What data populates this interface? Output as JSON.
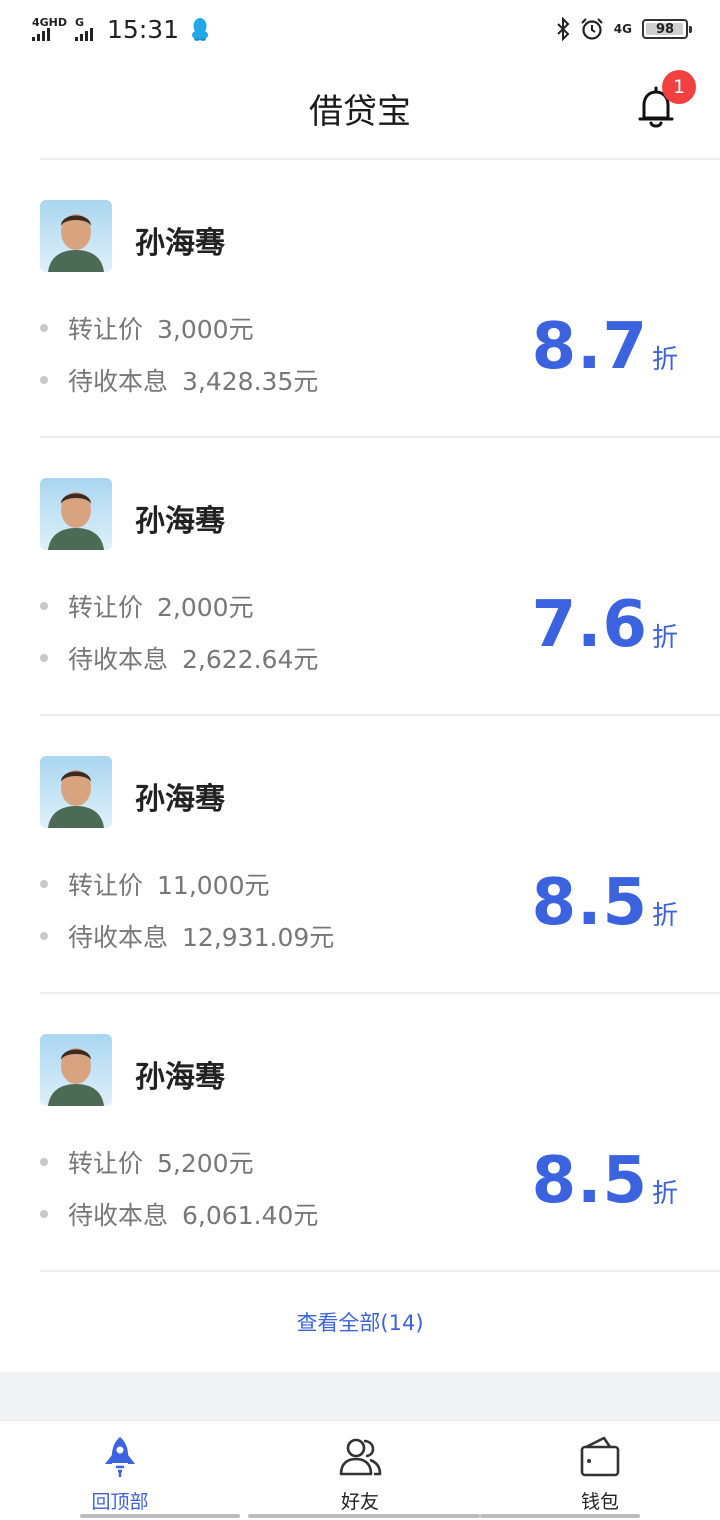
{
  "status_bar": {
    "sim1": "4GHD",
    "sim2": "G",
    "time": "15:31",
    "net": "4G",
    "battery": "98",
    "battery_level": 0.98
  },
  "header": {
    "title": "借贷宝",
    "notification_count": "1"
  },
  "cards": [
    {
      "name": "孙海骞",
      "transfer_label": "转让价",
      "transfer_value": "3,000元",
      "receivable_label": "待收本息",
      "receivable_value": "3,428.35元",
      "discount": "8.7",
      "discount_unit": "折"
    },
    {
      "name": "孙海骞",
      "transfer_label": "转让价",
      "transfer_value": "2,000元",
      "receivable_label": "待收本息",
      "receivable_value": "2,622.64元",
      "discount": "7.6",
      "discount_unit": "折"
    },
    {
      "name": "孙海骞",
      "transfer_label": "转让价",
      "transfer_value": "11,000元",
      "receivable_label": "待收本息",
      "receivable_value": "12,931.09元",
      "discount": "8.5",
      "discount_unit": "折"
    },
    {
      "name": "孙海骞",
      "transfer_label": "转让价",
      "transfer_value": "5,200元",
      "receivable_label": "待收本息",
      "receivable_value": "6,061.40元",
      "discount": "8.5",
      "discount_unit": "折"
    }
  ],
  "view_all": "查看全部(14)",
  "bottom_nav": {
    "items": [
      {
        "label": "回顶部",
        "icon": "rocket-icon",
        "active": true
      },
      {
        "label": "好友",
        "icon": "friends-icon",
        "active": false
      },
      {
        "label": "钱包",
        "icon": "wallet-icon",
        "active": false
      }
    ]
  },
  "colors": {
    "accent": "#3b63e0",
    "badge": "#f04040",
    "muted_text": "#777777"
  }
}
